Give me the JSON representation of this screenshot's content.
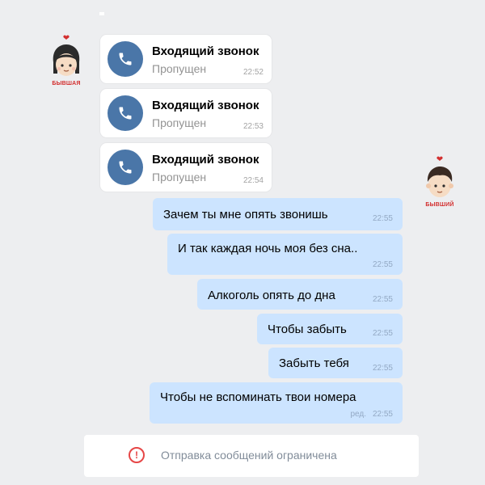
{
  "avatars": {
    "left_label": "БЫВШАЯ",
    "right_label": "БЫВШИЙ"
  },
  "calls": [
    {
      "title": "Входящий звонок",
      "status": "Пропущен",
      "time": "22:52"
    },
    {
      "title": "Входящий звонок",
      "status": "Пропущен",
      "time": "22:53"
    },
    {
      "title": "Входящий звонок",
      "status": "Пропущен",
      "time": "22:54"
    }
  ],
  "messages": [
    {
      "text": "Зачем ты мне опять звонишь",
      "time": "22:55"
    },
    {
      "text": "И так каждая ночь моя без сна..",
      "time": "22:55"
    },
    {
      "text": "Алкоголь опять до дна",
      "time": "22:55"
    },
    {
      "text": "Чтобы забыть",
      "time": "22:55"
    },
    {
      "text": "Забыть тебя",
      "time": "22:55"
    },
    {
      "text": "Чтобы не вспоминать твои номера",
      "time": "22:55",
      "edited": "ред."
    }
  ],
  "notice": {
    "icon_symbol": "!",
    "text": "Отправка сообщений ограничена"
  },
  "colors": {
    "background": "#edeef0",
    "bubble": "#cce4ff",
    "call_icon": "#4a76a8",
    "warning": "#e64646"
  }
}
